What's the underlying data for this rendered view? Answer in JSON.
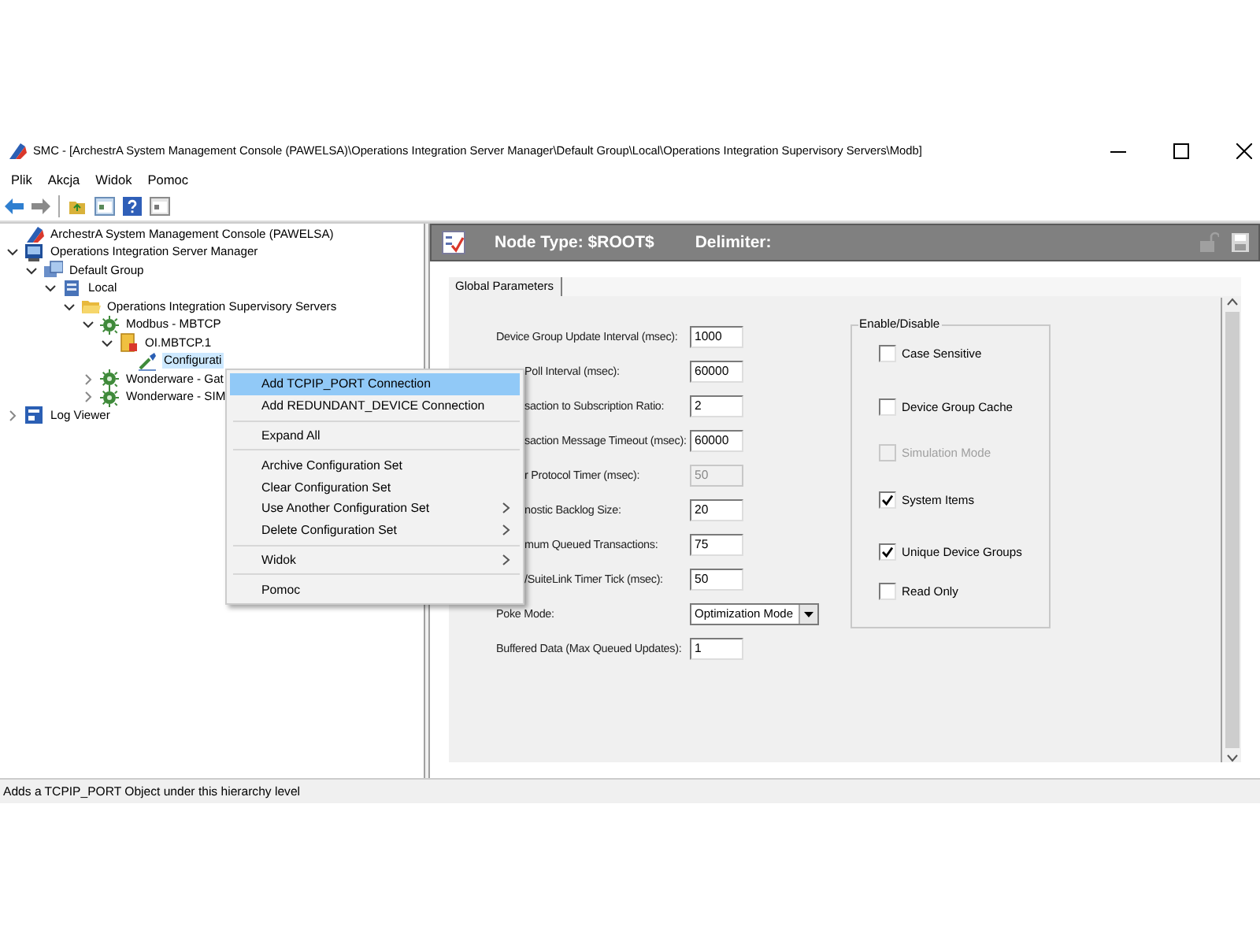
{
  "window": {
    "title": "SMC - [ArchestrA System Management Console (PAWELSA)\\Operations Integration Server Manager\\Default Group\\Local\\Operations Integration Supervisory Servers\\Modb]"
  },
  "menu_bar": [
    "Plik",
    "Akcja",
    "Widok",
    "Pomoc"
  ],
  "tree": [
    {
      "kind": "console",
      "label": "ArchestrA System Management Console (PAWELSA)",
      "selected": false
    },
    {
      "kind": "server",
      "label": "Operations Integration Server Manager",
      "expanded": true,
      "selected": false,
      "children": [
        {
          "kind": "group",
          "label": "Default Group",
          "expanded": true,
          "selected": false,
          "children": [
            {
              "kind": "computer",
              "label": "Local",
              "expanded": true,
              "selected": false,
              "children": [
                {
                  "kind": "folder",
                  "label": "Operations Integration Supervisory Servers",
                  "expanded": true,
                  "selected": false,
                  "children": [
                    {
                      "kind": "gear",
                      "label": "Modbus - MBTCP",
                      "expanded": true,
                      "selected": false,
                      "children": [
                        {
                          "kind": "object",
                          "label": "OI.MBTCP.1",
                          "expanded": true,
                          "selected": false,
                          "children": [
                            {
                              "kind": "config",
                              "label": "Configurati",
                              "selected": true
                            }
                          ]
                        }
                      ]
                    },
                    {
                      "kind": "gear",
                      "label": "Wonderware - Gat",
                      "expanded": false,
                      "selected": false
                    },
                    {
                      "kind": "gear",
                      "label": "Wonderware - SIM",
                      "expanded": false,
                      "selected": false
                    }
                  ]
                }
              ]
            }
          ]
        }
      ]
    },
    {
      "kind": "log",
      "label": "Log Viewer",
      "expanded": false,
      "selected": false
    }
  ],
  "context_menu": [
    {
      "kind": "item",
      "label": "Add TCPIP_PORT Connection",
      "submenu": false,
      "selected": true
    },
    {
      "kind": "item",
      "label": "Add REDUNDANT_DEVICE Connection",
      "submenu": false,
      "selected": false
    },
    {
      "kind": "separator"
    },
    {
      "kind": "item",
      "label": "Expand All",
      "submenu": false,
      "selected": false
    },
    {
      "kind": "separator"
    },
    {
      "kind": "item",
      "label": "Archive Configuration Set",
      "submenu": false,
      "selected": false
    },
    {
      "kind": "item",
      "label": "Clear Configuration Set",
      "submenu": false,
      "selected": false
    },
    {
      "kind": "item",
      "label": "Use Another Configuration Set",
      "submenu": true,
      "selected": false
    },
    {
      "kind": "item",
      "label": "Delete Configuration Set",
      "submenu": true,
      "selected": false
    },
    {
      "kind": "separator"
    },
    {
      "kind": "item",
      "label": "Widok",
      "submenu": true,
      "selected": false
    },
    {
      "kind": "separator"
    },
    {
      "kind": "item",
      "label": "Pomoc",
      "submenu": false,
      "selected": false
    }
  ],
  "header": {
    "node_type": "Node Type: $ROOT$",
    "delimiter": "Delimiter:"
  },
  "tabs": [
    {
      "label": "Global Parameters",
      "selected": true
    }
  ],
  "form": [
    {
      "kind": "input",
      "label": "Device Group Update Interval (msec):",
      "value": "1000",
      "disabled": false,
      "clipped": false
    },
    {
      "kind": "input",
      "label": "Poll Interval (msec):",
      "value": "60000",
      "disabled": false,
      "clipped": true
    },
    {
      "kind": "input",
      "label": "saction to Subscription Ratio:",
      "value": "2",
      "disabled": false,
      "clipped": true
    },
    {
      "kind": "input",
      "label": "saction Message Timeout (msec):",
      "value": "60000",
      "disabled": false,
      "clipped": true
    },
    {
      "kind": "input",
      "label": "r Protocol Timer (msec):",
      "value": "50",
      "disabled": true,
      "clipped": true
    },
    {
      "kind": "input",
      "label": "nostic Backlog Size:",
      "value": "20",
      "disabled": false,
      "clipped": true
    },
    {
      "kind": "input",
      "label": "mum Queued Transactions:",
      "value": "75",
      "disabled": false,
      "clipped": true
    },
    {
      "kind": "input",
      "label": "/SuiteLink Timer Tick (msec):",
      "value": "50",
      "disabled": false,
      "clipped": true
    },
    {
      "kind": "select",
      "label": "Poke Mode:",
      "value": "Optimization Mode",
      "disabled": false,
      "clipped": false
    },
    {
      "kind": "input",
      "label": "Buffered Data (Max Queued Updates):",
      "value": "1",
      "disabled": false,
      "clipped": false
    }
  ],
  "enable_disable": {
    "title": "Enable/Disable",
    "items": [
      {
        "label": "Case Sensitive",
        "checked": false,
        "disabled": false
      },
      {
        "label": "Device Group Cache",
        "checked": false,
        "disabled": false
      },
      {
        "label": "Simulation Mode",
        "checked": false,
        "disabled": true
      },
      {
        "label": "System Items",
        "checked": true,
        "disabled": false
      },
      {
        "label": "Unique Device Groups",
        "checked": true,
        "disabled": false
      },
      {
        "label": "Read Only",
        "checked": false,
        "disabled": false
      }
    ]
  },
  "status_bar": "Adds a TCPIP_PORT Object under this hierarchy level"
}
